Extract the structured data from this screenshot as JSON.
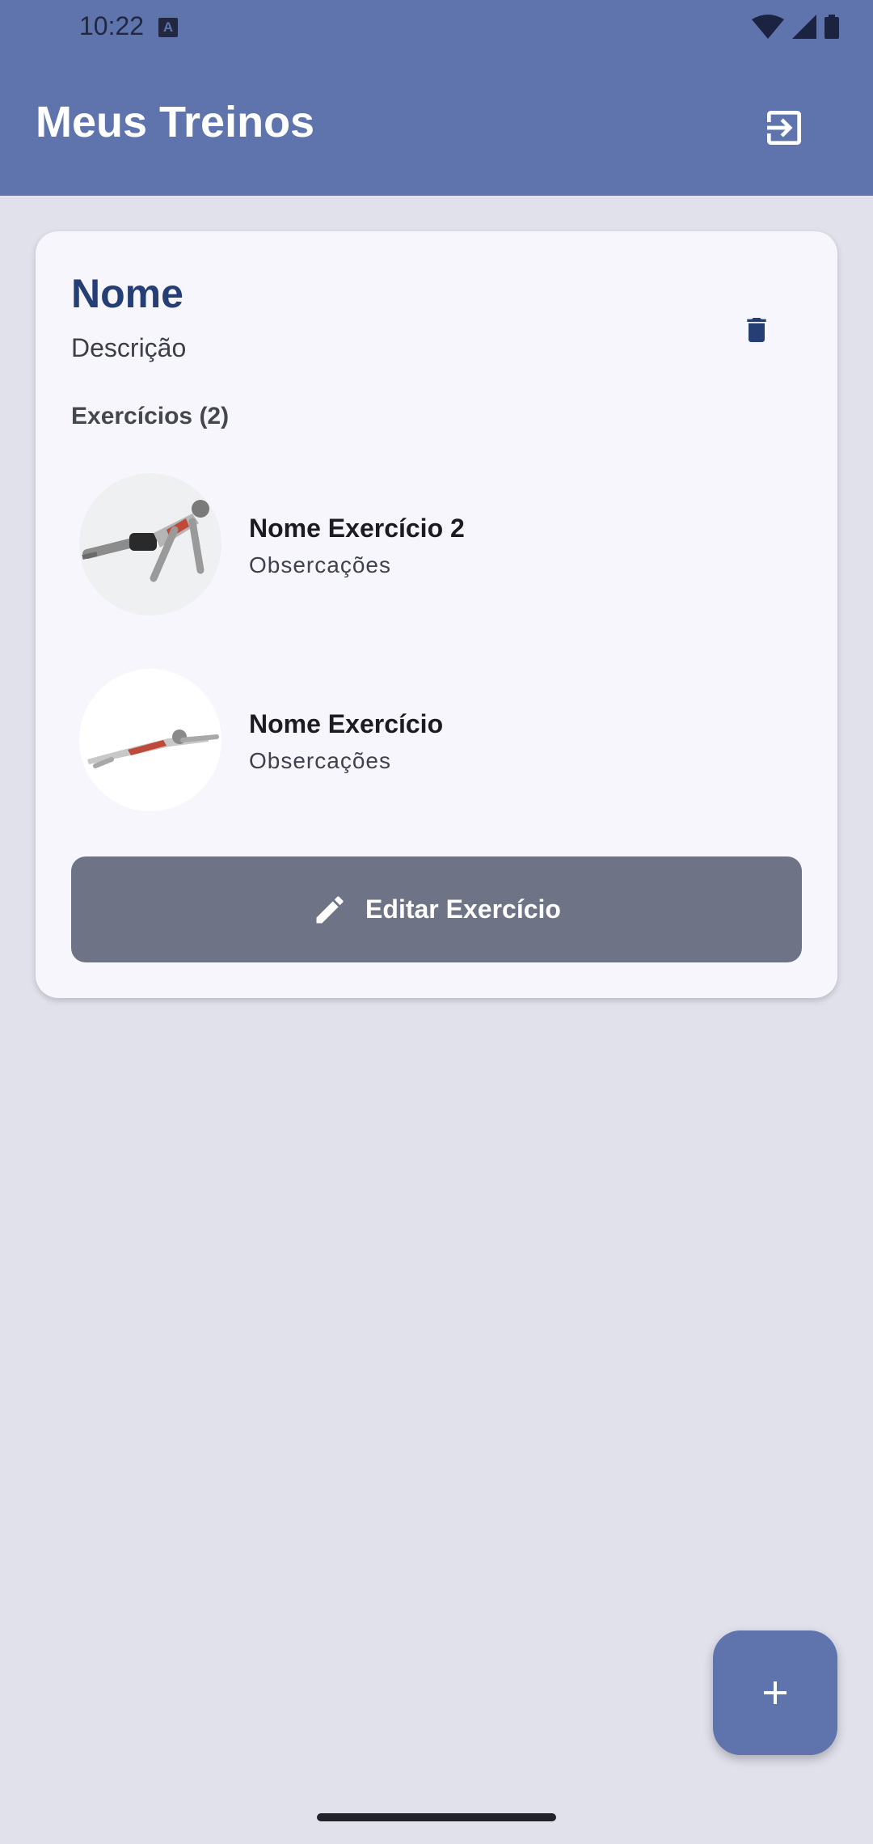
{
  "status_bar": {
    "time": "10:22",
    "notification_glyph": "A"
  },
  "app_bar": {
    "title": "Meus Treinos",
    "logout_icon": "logout-icon"
  },
  "workout": {
    "name": "Nome",
    "description": "Descrição",
    "exercises_header": "Exercícios (2)",
    "exercises": [
      {
        "name": "Nome Exercício 2",
        "notes": "Obsercações",
        "thumb": "push-up-illustration"
      },
      {
        "name": "Nome Exercício",
        "notes": "Obsercações",
        "thumb": "prone-exercise-illustration"
      }
    ],
    "edit_button_label": "Editar Exercício"
  },
  "colors": {
    "primary": "#5f74ad",
    "background": "#e1e1ec",
    "card": "#f7f6fd",
    "title": "#253e74",
    "edit_button": "#6e7385"
  },
  "fab_icon": "plus-icon"
}
